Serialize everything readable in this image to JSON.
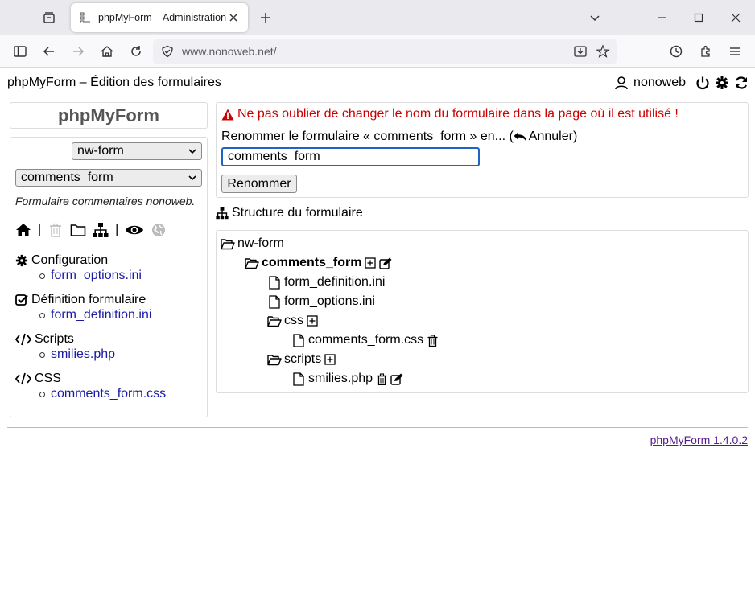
{
  "browser": {
    "tab_title": "phpMyForm – Administration",
    "url": "www.nonoweb.net/"
  },
  "header": {
    "title": "phpMyForm – Édition des formulaires",
    "username": "nonoweb"
  },
  "sidebar": {
    "brand": "phpMyForm",
    "site_select": "nw-form",
    "form_select": "comments_form",
    "description": "Formulaire commentaires nonoweb.",
    "separator": "|",
    "sections": [
      {
        "title": "Configuration",
        "link": "form_options.ini",
        "icon": "gear-icon"
      },
      {
        "title": "Définition formulaire",
        "link": "form_definition.ini",
        "icon": "checkbox-icon"
      },
      {
        "title": "Scripts",
        "link": "smilies.php",
        "icon": "code-icon"
      },
      {
        "title": "CSS",
        "link": "comments_form.css",
        "icon": "code-icon"
      }
    ]
  },
  "main": {
    "warning": "Ne pas oublier de changer le nom du formulaire dans la page où il est utilisé !",
    "rename_prompt": "Renommer le formulaire « comments_form » en... (",
    "cancel_label": "Annuler)",
    "input_value": "comments_form",
    "rename_button": "Renommer",
    "structure_title": "Structure du formulaire",
    "tree": {
      "root": "nw-form",
      "form": "comments_form",
      "files": [
        "form_definition.ini",
        "form_options.ini"
      ],
      "css_folder": "css",
      "css_file": "comments_form.css",
      "scripts_folder": "scripts",
      "scripts_file": "smilies.php"
    }
  },
  "footer": {
    "version": "phpMyForm 1.4.0.2"
  },
  "colors": {
    "warning": "#cc0000",
    "link": "#1a1aa6",
    "visited": "#551a8b",
    "focus": "#1f64c4"
  }
}
